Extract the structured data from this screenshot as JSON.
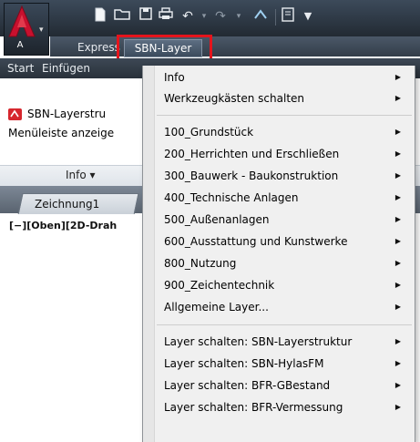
{
  "app": {
    "logo_letter": "A",
    "accent": "#c8102e"
  },
  "menubar": {
    "items": [
      {
        "label": "Express"
      },
      {
        "label": "SBN-Layer"
      }
    ]
  },
  "ribbon": {
    "tabs": [
      {
        "label": "Start"
      },
      {
        "label": "Einfügen"
      }
    ],
    "panel_items": [
      {
        "label": "SBN-Layerstru"
      },
      {
        "label": "Menüleiste anzeige"
      }
    ],
    "panel_footer": "Info ▾"
  },
  "document": {
    "tab_label": "Zeichnung1",
    "viewport_label": "[−][Oben][2D-Drah"
  },
  "dropdown": {
    "items": [
      {
        "label": "Info"
      },
      {
        "label": "Werkzeugkästen schalten"
      },
      {
        "label": "100_Grundstück"
      },
      {
        "label": "200_Herrichten und Erschließen"
      },
      {
        "label": "300_Bauwerk - Baukonstruktion"
      },
      {
        "label": "400_Technische Anlagen"
      },
      {
        "label": "500_Außenanlagen"
      },
      {
        "label": "600_Ausstattung und Kunstwerke"
      },
      {
        "label": "800_Nutzung"
      },
      {
        "label": "900_Zeichentechnik"
      },
      {
        "label": "Allgemeine Layer..."
      },
      {
        "label": "Layer schalten: SBN-Layerstruktur"
      },
      {
        "label": "Layer schalten: SBN-HylasFM"
      },
      {
        "label": "Layer schalten: BFR-GBestand"
      },
      {
        "label": "Layer schalten: BFR-Vermessung"
      }
    ]
  },
  "icons": {
    "app": "autocad-logo-icon",
    "new": "new-file-icon",
    "open": "open-folder-icon",
    "save": "save-icon",
    "print": "print-icon",
    "undo": "undo-icon",
    "redo": "redo-icon",
    "workspace": "workspace-icon",
    "properties": "properties-icon",
    "customize": "customize-quick-access-icon",
    "submenu": "submenu-arrow-icon",
    "layer_tool": "sbn-layer-tool-icon"
  }
}
